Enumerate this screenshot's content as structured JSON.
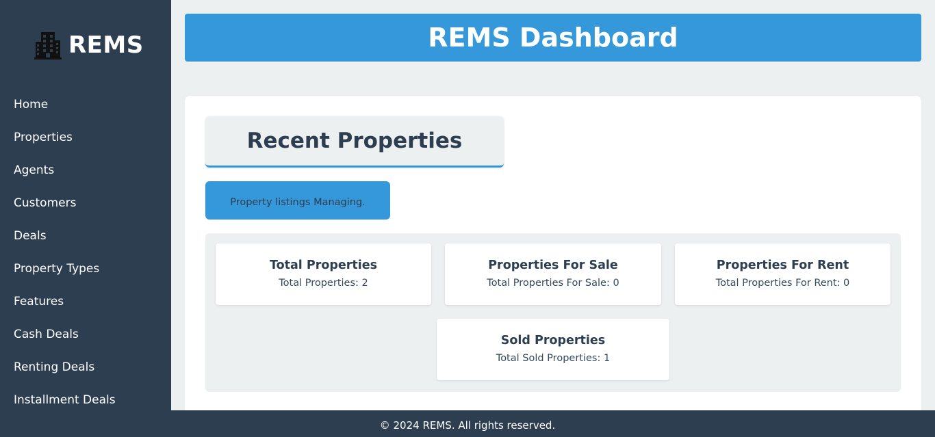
{
  "sidebar": {
    "brand": {
      "icon": "building-icon",
      "name": "REMS"
    },
    "items": [
      {
        "label": "Home"
      },
      {
        "label": "Properties"
      },
      {
        "label": "Agents"
      },
      {
        "label": "Customers"
      },
      {
        "label": "Deals"
      },
      {
        "label": "Property Types"
      },
      {
        "label": "Features"
      },
      {
        "label": "Cash Deals"
      },
      {
        "label": "Renting Deals"
      },
      {
        "label": "Installment Deals"
      }
    ]
  },
  "header": {
    "title": "REMS Dashboard"
  },
  "main": {
    "section_title": "Recent Properties",
    "info_text": "Property listings Managing.",
    "stats": [
      {
        "title": "Total Properties",
        "value": "Total Properties: 2"
      },
      {
        "title": "Properties For Sale",
        "value": "Total Properties For Sale: 0"
      },
      {
        "title": "Properties For Rent",
        "value": "Total Properties For Rent: 0"
      },
      {
        "title": "Sold Properties",
        "value": "Total Sold Properties: 1"
      }
    ]
  },
  "footer": {
    "text": "© 2024 REMS. All rights reserved."
  },
  "colors": {
    "sidebar_bg": "#2c3e50",
    "accent": "#3498db",
    "page_bg": "#ecf0f1",
    "text_dark": "#2c3e50"
  }
}
